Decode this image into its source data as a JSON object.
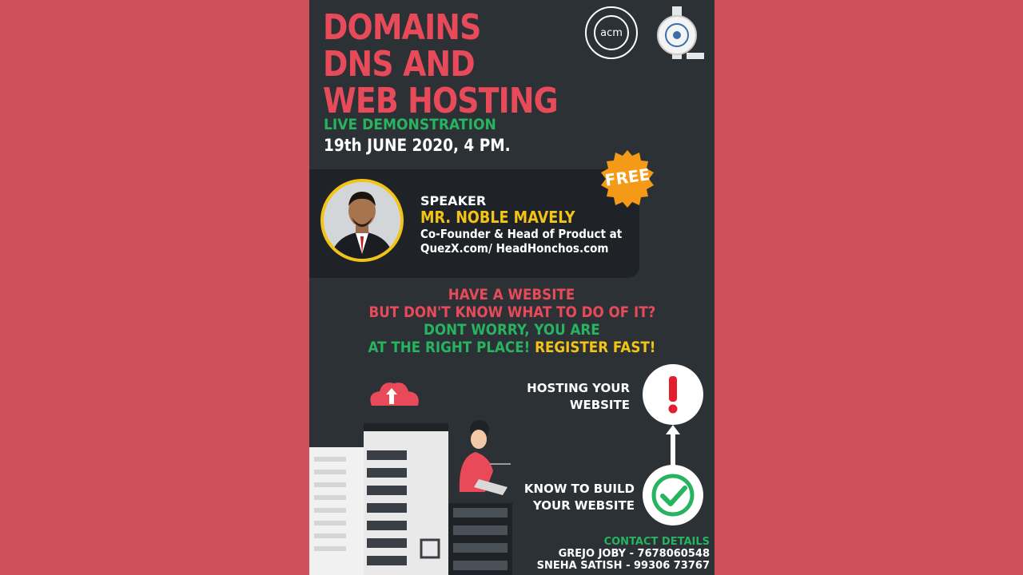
{
  "title_lines": [
    "DOMAINS",
    "DNS AND",
    "WEB HOSTING"
  ],
  "subtitle": "LIVE DEMONSTRATION",
  "date": "19th JUNE 2020, 4 PM.",
  "logos": {
    "acm_text": "acm"
  },
  "badge": "FREE",
  "speaker": {
    "label": "SPEAKER",
    "name": "MR. NOBLE MAVELY",
    "role": "Co-Founder & Head of Product at",
    "site": "QuezX.com/ HeadHonchos.com"
  },
  "message": {
    "line1": "HAVE A WEBSITE",
    "line2": "BUT DON'T KNOW WHAT TO DO OF IT?",
    "line3": "DONT WORRY, YOU ARE",
    "line4a": "AT THE RIGHT PLACE!",
    "line4b": "REGISTER FAST!"
  },
  "steps": {
    "hosting_line1": "HOSTING YOUR",
    "hosting_line2": "WEBSITE",
    "build_line1": "KNOW TO BUILD",
    "build_line2": "YOUR WEBSITE"
  },
  "contact": {
    "title": "CONTACT DETAILS",
    "line1": "GREJO JOBY - 7678060548",
    "line2": "SNEHA SATISH - 99306 73767"
  },
  "colors": {
    "background": "#d0505a",
    "poster": "#2c3136",
    "accent_red": "#e84a5a",
    "accent_green": "#27b35f",
    "accent_yellow": "#f3c316"
  }
}
